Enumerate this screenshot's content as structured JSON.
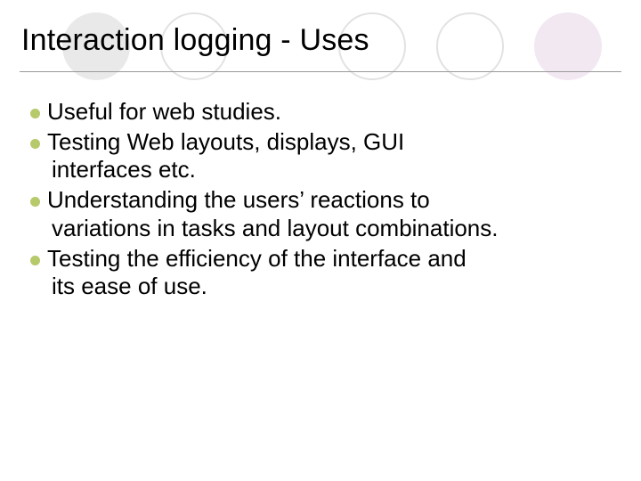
{
  "colors": {
    "bullet": "#b6c96b",
    "circle_filled_grey": "#e9e9e9",
    "circle_outline": "#e2e2e2",
    "circle_filled_lilac": "#f2e8f2",
    "rule": "#9a9a9a"
  },
  "title": "Interaction logging - Uses",
  "bullets": [
    {
      "first": "Useful for web studies.",
      "rest": []
    },
    {
      "first": "Testing Web layouts, displays, GUI",
      "rest": [
        "interfaces etc."
      ]
    },
    {
      "first": "Understanding the users’ reactions to",
      "rest": [
        "variations in tasks and layout combinations."
      ]
    },
    {
      "first": "Testing the efficiency of the interface and",
      "rest": [
        "its ease of use."
      ]
    }
  ]
}
